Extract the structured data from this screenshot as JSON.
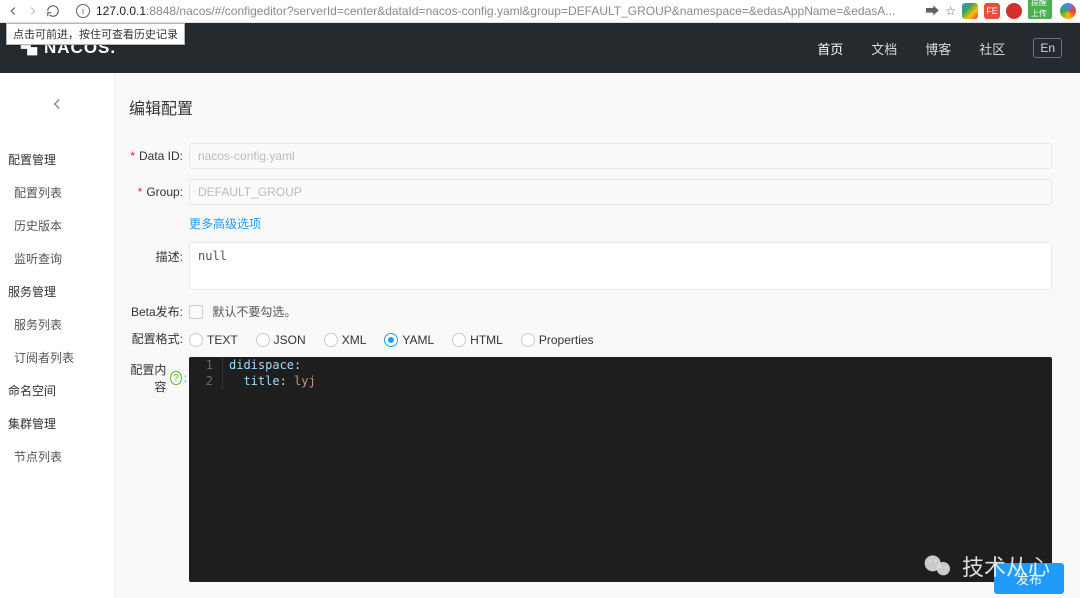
{
  "browser": {
    "url_host": "127.0.0.1",
    "url_port_path": ":8848/nacos/#/configeditor?serverId=center&dataId=nacos-config.yaml&group=DEFAULT_GROUP&namespace=&edasAppName=&edasA...",
    "tooltip": "点击可前进，按住可查看历史记录"
  },
  "header": {
    "logo": "NACOS.",
    "nav": [
      "首页",
      "文档",
      "博客",
      "社区"
    ],
    "lang": "En"
  },
  "sidebar": {
    "groups": [
      {
        "title": "配置管理",
        "items": [
          "配置列表",
          "历史版本",
          "监听查询"
        ]
      },
      {
        "title": "服务管理",
        "items": [
          "服务列表",
          "订阅者列表"
        ]
      }
    ],
    "loose": [
      "命名空间",
      "集群管理"
    ],
    "loose_sub": [
      "节点列表"
    ]
  },
  "page": {
    "title": "编辑配置",
    "labels": {
      "data_id": "Data ID:",
      "group": "Group:",
      "desc": "描述:",
      "beta": "Beta发布:",
      "format": "配置格式:",
      "content": "配置内容"
    },
    "values": {
      "data_id": "nacos-config.yaml",
      "group": "DEFAULT_GROUP",
      "desc": "null",
      "advanced_link": "更多高级选项",
      "beta_hint": "默认不要勾选。"
    },
    "formats": [
      "TEXT",
      "JSON",
      "XML",
      "YAML",
      "HTML",
      "Properties"
    ],
    "selected_format": "YAML",
    "editor_lines": [
      {
        "n": 1,
        "indent": "",
        "key": "didispace",
        "val": ""
      },
      {
        "n": 2,
        "indent": "  ",
        "key": "title",
        "val": "lyj"
      }
    ],
    "publish_btn": "发布"
  },
  "watermark": "技术从心"
}
